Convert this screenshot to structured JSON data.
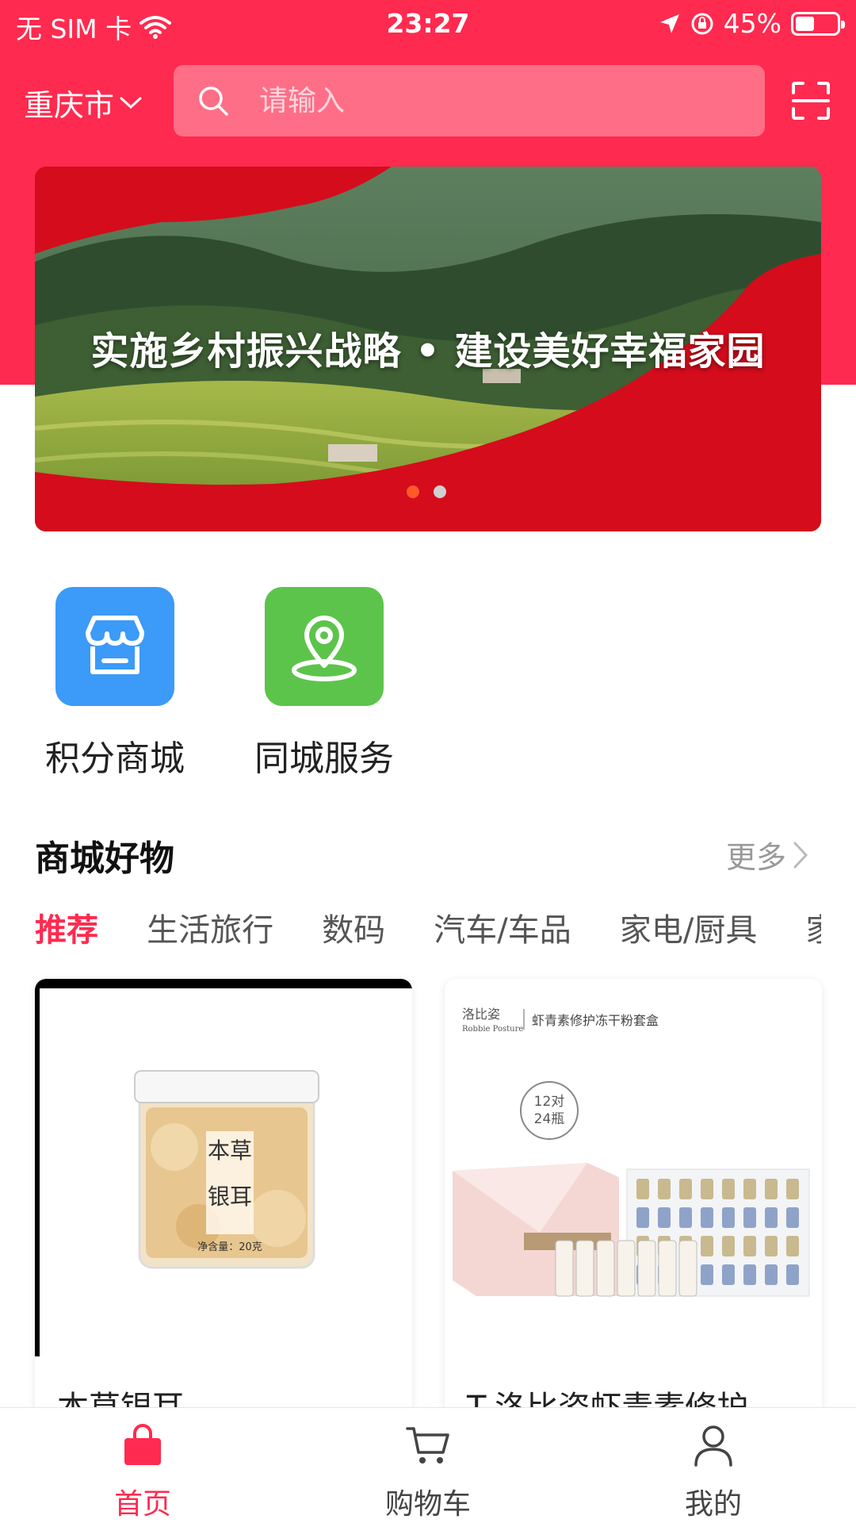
{
  "status_bar": {
    "carrier": "无 SIM 卡",
    "time": "23:27",
    "battery_percent": "45%",
    "battery_level": 0.45
  },
  "header": {
    "city": "重庆市",
    "search_placeholder": "请输入"
  },
  "banner": {
    "title": "实施乡村振兴战略 • 建设美好幸福家园",
    "slide_count": 2,
    "active_slide": 1
  },
  "entries": [
    {
      "label": "积分商城",
      "icon": "store-icon",
      "color": "#3c9af8"
    },
    {
      "label": "同城服务",
      "icon": "location-pin-icon",
      "color": "#5cc44b"
    }
  ],
  "section": {
    "title": "商城好物",
    "more_label": "更多"
  },
  "category_tabs": [
    {
      "label": "推荐",
      "active": true
    },
    {
      "label": "生活旅行",
      "active": false
    },
    {
      "label": "数码",
      "active": false
    },
    {
      "label": "汽车/车品",
      "active": false
    },
    {
      "label": "家电/厨具",
      "active": false
    },
    {
      "label": "家",
      "active": false
    }
  ],
  "products": [
    {
      "title": "本草银耳",
      "image_text": {
        "line1": "本草",
        "line2": "银耳",
        "weight": "净含量：20克"
      }
    },
    {
      "title": "T-洛比姿虾青素修护",
      "image_text": {
        "brand": "洛比姿",
        "brand_en": "Robbie Posture",
        "product": "虾青素修护冻干粉套盒",
        "badge_line1": "12对",
        "badge_line2": "24瓶"
      }
    }
  ],
  "tabbar": [
    {
      "label": "首页",
      "icon": "shopping-bag-icon",
      "active": true
    },
    {
      "label": "购物车",
      "icon": "cart-icon",
      "active": false
    },
    {
      "label": "我的",
      "icon": "user-icon",
      "active": false
    }
  ],
  "colors": {
    "brand": "#ff2a4f",
    "dot_active": "#ff5a28"
  }
}
